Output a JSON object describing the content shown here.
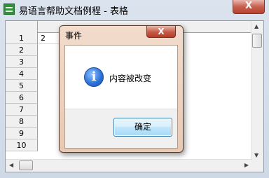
{
  "window": {
    "title": "易语言帮助文档例程 - 表格",
    "close_glyph": "X"
  },
  "grid": {
    "rows": [
      "1",
      "2",
      "3",
      "4",
      "5",
      "6",
      "7",
      "8",
      "9",
      "10"
    ],
    "first_cell_value": "2"
  },
  "dialog": {
    "title": "事件",
    "close_glyph": "X",
    "message": "内容被改变",
    "icon": "info-icon",
    "ok_label": "确定"
  }
}
